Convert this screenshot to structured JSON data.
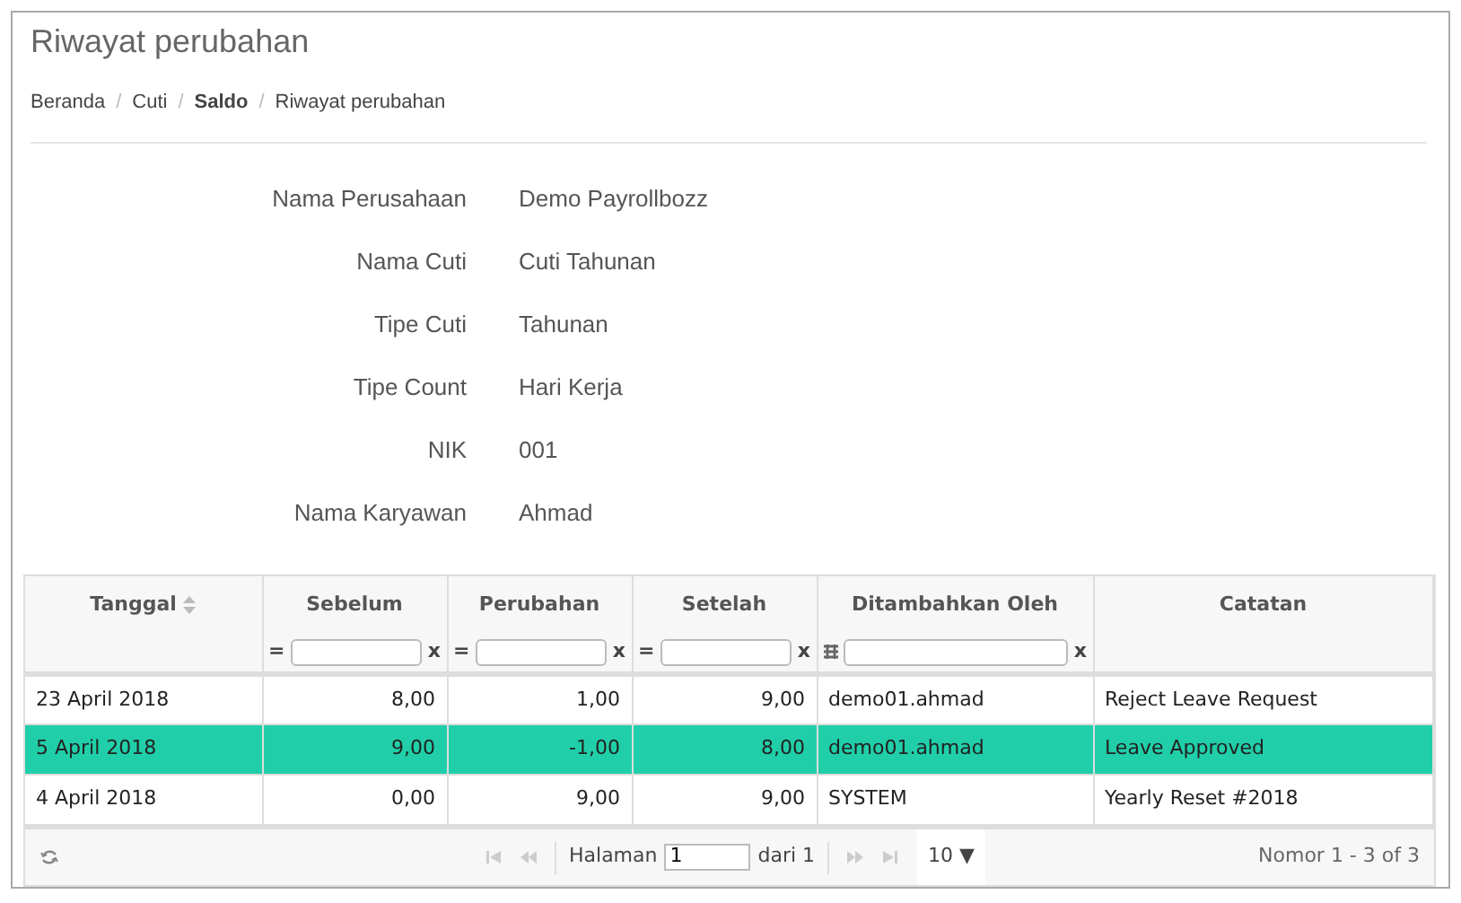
{
  "page": {
    "title": "Riwayat perubahan"
  },
  "breadcrumb": {
    "separator": "/",
    "items": [
      {
        "label": "Beranda"
      },
      {
        "label": "Cuti"
      },
      {
        "label": "Saldo",
        "bold": true
      },
      {
        "label": "Riwayat perubahan"
      }
    ]
  },
  "details": [
    {
      "label": "Nama Perusahaan",
      "value": "Demo Payrollbozz"
    },
    {
      "label": "Nama Cuti",
      "value": "Cuti Tahunan"
    },
    {
      "label": "Tipe Cuti",
      "value": "Tahunan"
    },
    {
      "label": "Tipe Count",
      "value": "Hari Kerja"
    },
    {
      "label": "NIK",
      "value": "001"
    },
    {
      "label": "Nama Karyawan",
      "value": "Ahmad"
    }
  ],
  "table": {
    "columns": [
      {
        "label": "Tanggal",
        "kind": "text",
        "sortable": true
      },
      {
        "label": "Sebelum",
        "kind": "number",
        "filter": {
          "kind": "equals",
          "operator": "=",
          "clear": "x"
        }
      },
      {
        "label": "Perubahan",
        "kind": "number",
        "filter": {
          "kind": "equals",
          "operator": "=",
          "clear": "x"
        }
      },
      {
        "label": "Setelah",
        "kind": "number",
        "filter": {
          "kind": "equals",
          "operator": "=",
          "clear": "x"
        }
      },
      {
        "label": "Ditambahkan Oleh",
        "kind": "text",
        "filter": {
          "kind": "contains",
          "clear": "x"
        }
      },
      {
        "label": "Catatan",
        "kind": "text"
      }
    ],
    "rows": [
      {
        "selected": false,
        "cells": [
          "23 April 2018",
          "8,00",
          "1,00",
          "9,00",
          "demo01.ahmad",
          "Reject Leave Request"
        ]
      },
      {
        "selected": true,
        "cells": [
          "5 April 2018",
          "9,00",
          "-1,00",
          "8,00",
          "demo01.ahmad",
          "Leave Approved"
        ]
      },
      {
        "selected": false,
        "cells": [
          "4 April 2018",
          "0,00",
          "9,00",
          "9,00",
          "SYSTEM",
          "Yearly Reset #2018"
        ]
      }
    ]
  },
  "pager": {
    "page_label": "Halaman",
    "page_value": "1",
    "of_label": "dari 1",
    "page_size": "10",
    "size_caret": "▼",
    "summary": "Nomor 1 - 3 of 3"
  }
}
